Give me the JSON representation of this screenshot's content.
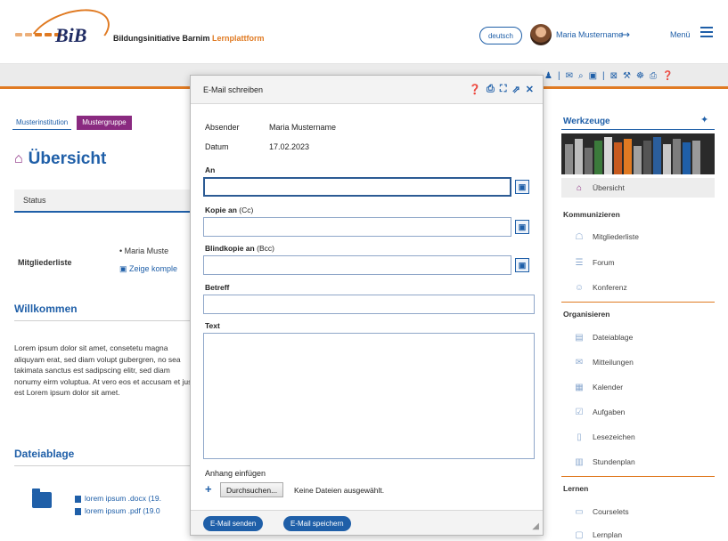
{
  "header": {
    "logo_text": "BiB",
    "brand_name": "Bildungsinitiative Barnim",
    "brand_accent": "Lernplattform",
    "language": "deutsch",
    "user_name": "Maria Mustername",
    "menu_label": "Menü"
  },
  "breadcrumb": {
    "institution": "Musterinstitution",
    "group": "Mustergruppe"
  },
  "main": {
    "page_title": "Übersicht",
    "status_tab": "Status",
    "members_label": "Mitgliederliste",
    "member_first": "Maria Muste",
    "member_show_all": "Zeige komple",
    "welcome_title": "Willkommen",
    "lorem_text": "Lorem ipsum dolor sit amet, consetetu magna aliquyam erat, sed diam volupt gubergren, no sea takimata sanctus est sadipscing elitr, sed diam nonumy eirm voluptua. At vero eos et accusam et jus est Lorem ipsum dolor sit amet.",
    "files_title": "Dateiablage",
    "files": [
      "lorem ipsum .docx (19.",
      "lorem ipsum .pdf (19.0"
    ]
  },
  "sidebar": {
    "title": "Werkzeuge",
    "overview": "Übersicht",
    "group_communicate": "Kommunizieren",
    "members": "Mitgliederliste",
    "forum": "Forum",
    "conference": "Konferenz",
    "group_organize": "Organisieren",
    "files": "Dateiablage",
    "messages": "Mitteilungen",
    "calendar": "Kalender",
    "tasks": "Aufgaben",
    "bookmarks": "Lesezeichen",
    "schedule": "Stundenplan",
    "group_learn": "Lernen",
    "courselets": "Courselets",
    "learnplan": "Lernplan"
  },
  "modal": {
    "title": "E-Mail schreiben",
    "sender_label": "Absender",
    "sender_value": "Maria Mustername",
    "date_label": "Datum",
    "date_value": "17.02.2023",
    "to_label": "An",
    "cc_label": "Kopie an",
    "cc_hint": "(Cc)",
    "bcc_label": "Blindkopie an",
    "bcc_hint": "(Bcc)",
    "subject_label": "Betreff",
    "text_label": "Text",
    "attach_label": "Anhang einfügen",
    "browse_button": "Durchsuchen...",
    "no_file": "Keine Dateien ausgewählt.",
    "send_button": "E-Mail senden",
    "save_button": "E-Mail speichern"
  },
  "colors": {
    "brand_blue": "#1f5fa8",
    "brand_orange": "#e07a22",
    "brand_purple": "#8a2a80"
  }
}
